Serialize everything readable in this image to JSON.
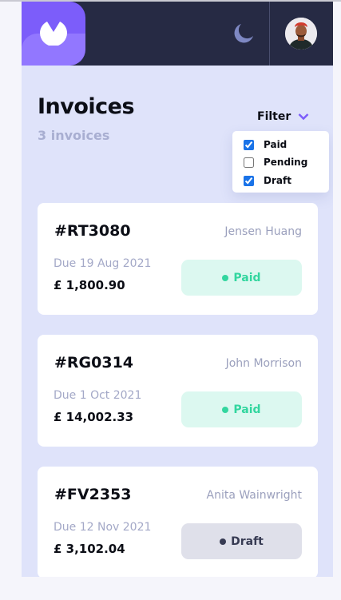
{
  "header": {
    "logo_icon": "logo-icon",
    "theme_icon": "moon-icon",
    "avatar_icon": "avatar",
    "colors": {
      "bar": "#262a44",
      "logo": "#7c5dfa",
      "accent": "#7c5dfa"
    }
  },
  "page": {
    "title": "Invoices",
    "count_label": "3 invoices"
  },
  "filter": {
    "label": "Filter",
    "icon": "chevron-down-icon",
    "options": [
      {
        "label": "Paid",
        "checked": true
      },
      {
        "label": "Pending",
        "checked": false
      },
      {
        "label": "Draft",
        "checked": true
      }
    ]
  },
  "invoices": [
    {
      "hash": "#",
      "id": "RT3080",
      "client": "Jensen Huang",
      "due": "Due 19 Aug 2021",
      "amount": "£ 1,800.90",
      "status": "Paid",
      "status_color": "#33d69f"
    },
    {
      "hash": "#",
      "id": "RG0314",
      "client": "John Morrison",
      "due": "Due 1 Oct 2021",
      "amount": "£ 14,002.33",
      "status": "Paid",
      "status_color": "#33d69f"
    },
    {
      "hash": "#",
      "id": "FV2353",
      "client": "Anita Wainwright",
      "due": "Due 12 Nov 2021",
      "amount": "£ 3,102.04",
      "status": "Draft",
      "status_color": "#373b53"
    }
  ]
}
